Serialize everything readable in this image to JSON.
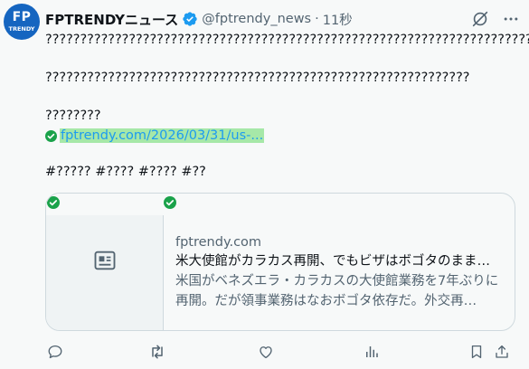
{
  "post": {
    "avatar": {
      "line1": "FP",
      "line2": "TRENDY"
    },
    "author_name": "FPTRENDYニュース",
    "handle": "@fptrendy_news",
    "separator": "·",
    "time": "11秒",
    "text_line1": "??????????????????????????????????????????????????????????????????????",
    "text_line2": "?????????????????????????????????????????????????????????????",
    "text_line3": "????????",
    "link": "fptrendy.com/2026/03/31/us-...",
    "hashtags": "#????? #???? #???? #??"
  },
  "card": {
    "domain": "fptrendy.com",
    "title": "米大使館がカラカス再開、でもビザはボゴタのまま…",
    "description": "米国がベネズエラ・カラカスの大使館業務を7年ぶりに再開。だが領事業務はなおボゴタ依存だ。外交再…"
  },
  "icons": {
    "verified": "verified-badge-icon",
    "grok": "grok-icon",
    "more": "more-icon",
    "reply": "reply-icon",
    "repost": "repost-icon",
    "like": "like-icon",
    "views": "views-icon",
    "bookmark": "bookmark-icon",
    "share": "share-icon",
    "article": "article-icon",
    "check": "check-icon"
  },
  "colors": {
    "brand_blue": "#1d9bf0",
    "avatar_bg": "#1565c0",
    "check_green": "#1aa24a",
    "link_highlight": "#a6e8a8"
  }
}
